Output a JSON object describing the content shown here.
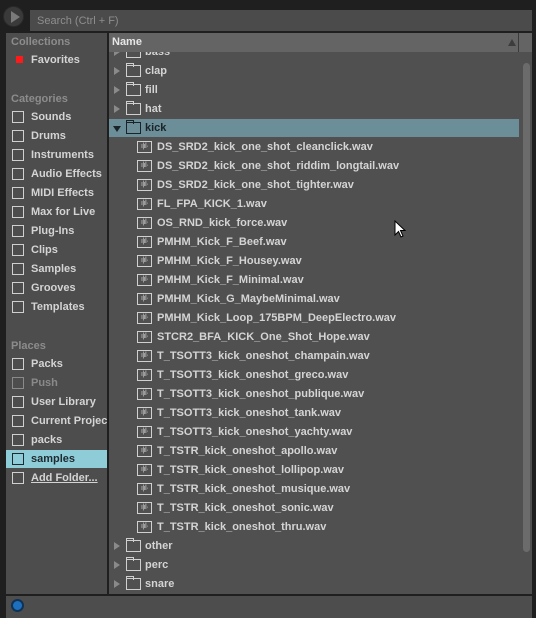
{
  "search": {
    "placeholder": "Search (Ctrl + F)"
  },
  "sidebar": {
    "collections_label": "Collections",
    "favorites": "Favorites",
    "favorites_color": "#ff1a1a",
    "categories_label": "Categories",
    "categories": [
      {
        "label": "Sounds",
        "icon": "music-note-icon"
      },
      {
        "label": "Drums",
        "icon": "drum-grid-icon"
      },
      {
        "label": "Instruments",
        "icon": "instrument-knob-icon"
      },
      {
        "label": "Audio Effects",
        "icon": "audio-effects-icon"
      },
      {
        "label": "MIDI Effects",
        "icon": "midi-effects-icon"
      },
      {
        "label": "Max for Live",
        "icon": "max-for-live-icon"
      },
      {
        "label": "Plug-Ins",
        "icon": "plug-icon"
      },
      {
        "label": "Clips",
        "icon": "clip-play-icon"
      },
      {
        "label": "Samples",
        "icon": "waveform-icon"
      },
      {
        "label": "Grooves",
        "icon": "groove-wave-icon"
      },
      {
        "label": "Templates",
        "icon": "template-icon"
      }
    ],
    "places_label": "Places",
    "places": [
      {
        "label": "Packs",
        "icon": "packs-icon"
      },
      {
        "label": "Push",
        "icon": "push-icon",
        "dimmed": true
      },
      {
        "label": "User Library",
        "icon": "user-icon"
      },
      {
        "label": "Current Projec",
        "icon": "project-folder-icon"
      },
      {
        "label": "packs",
        "icon": "folder-icon"
      },
      {
        "label": "samples",
        "icon": "folder-icon",
        "selected": true
      },
      {
        "label": "Add Folder...",
        "icon": "add-folder-icon"
      }
    ]
  },
  "browser": {
    "column_header": "Name",
    "folders_before": [
      "bass",
      "clap",
      "fill",
      "hat"
    ],
    "open_folder": "kick",
    "files": [
      "DS_SRD2_kick_one_shot_cleanclick.wav",
      "DS_SRD2_kick_one_shot_riddim_longtail.wav",
      "DS_SRD2_kick_one_shot_tighter.wav",
      "FL_FPA_KICK_1.wav",
      "OS_RND_kick_force.wav",
      "PMHM_Kick_F_Beef.wav",
      "PMHM_Kick_F_Housey.wav",
      "PMHM_Kick_F_Minimal.wav",
      "PMHM_Kick_G_MaybeMinimal.wav",
      "PMHM_Kick_Loop_175BPM_DeepElectro.wav",
      "STCR2_BFA_KICK_One_Shot_Hope.wav",
      "T_TSOTT3_kick_oneshot_champain.wav",
      "T_TSOTT3_kick_oneshot_greco.wav",
      "T_TSOTT3_kick_oneshot_publique.wav",
      "T_TSOTT3_kick_oneshot_tank.wav",
      "T_TSOTT3_kick_oneshot_yachty.wav",
      "T_TSTR_kick_oneshot_apollo.wav",
      "T_TSTR_kick_oneshot_lollipop.wav",
      "T_TSTR_kick_oneshot_musique.wav",
      "T_TSTR_kick_oneshot_sonic.wav",
      "T_TSTR_kick_oneshot_thru.wav"
    ],
    "folders_after": [
      "other",
      "perc",
      "snare"
    ],
    "selection_color": "#6c8e99"
  }
}
